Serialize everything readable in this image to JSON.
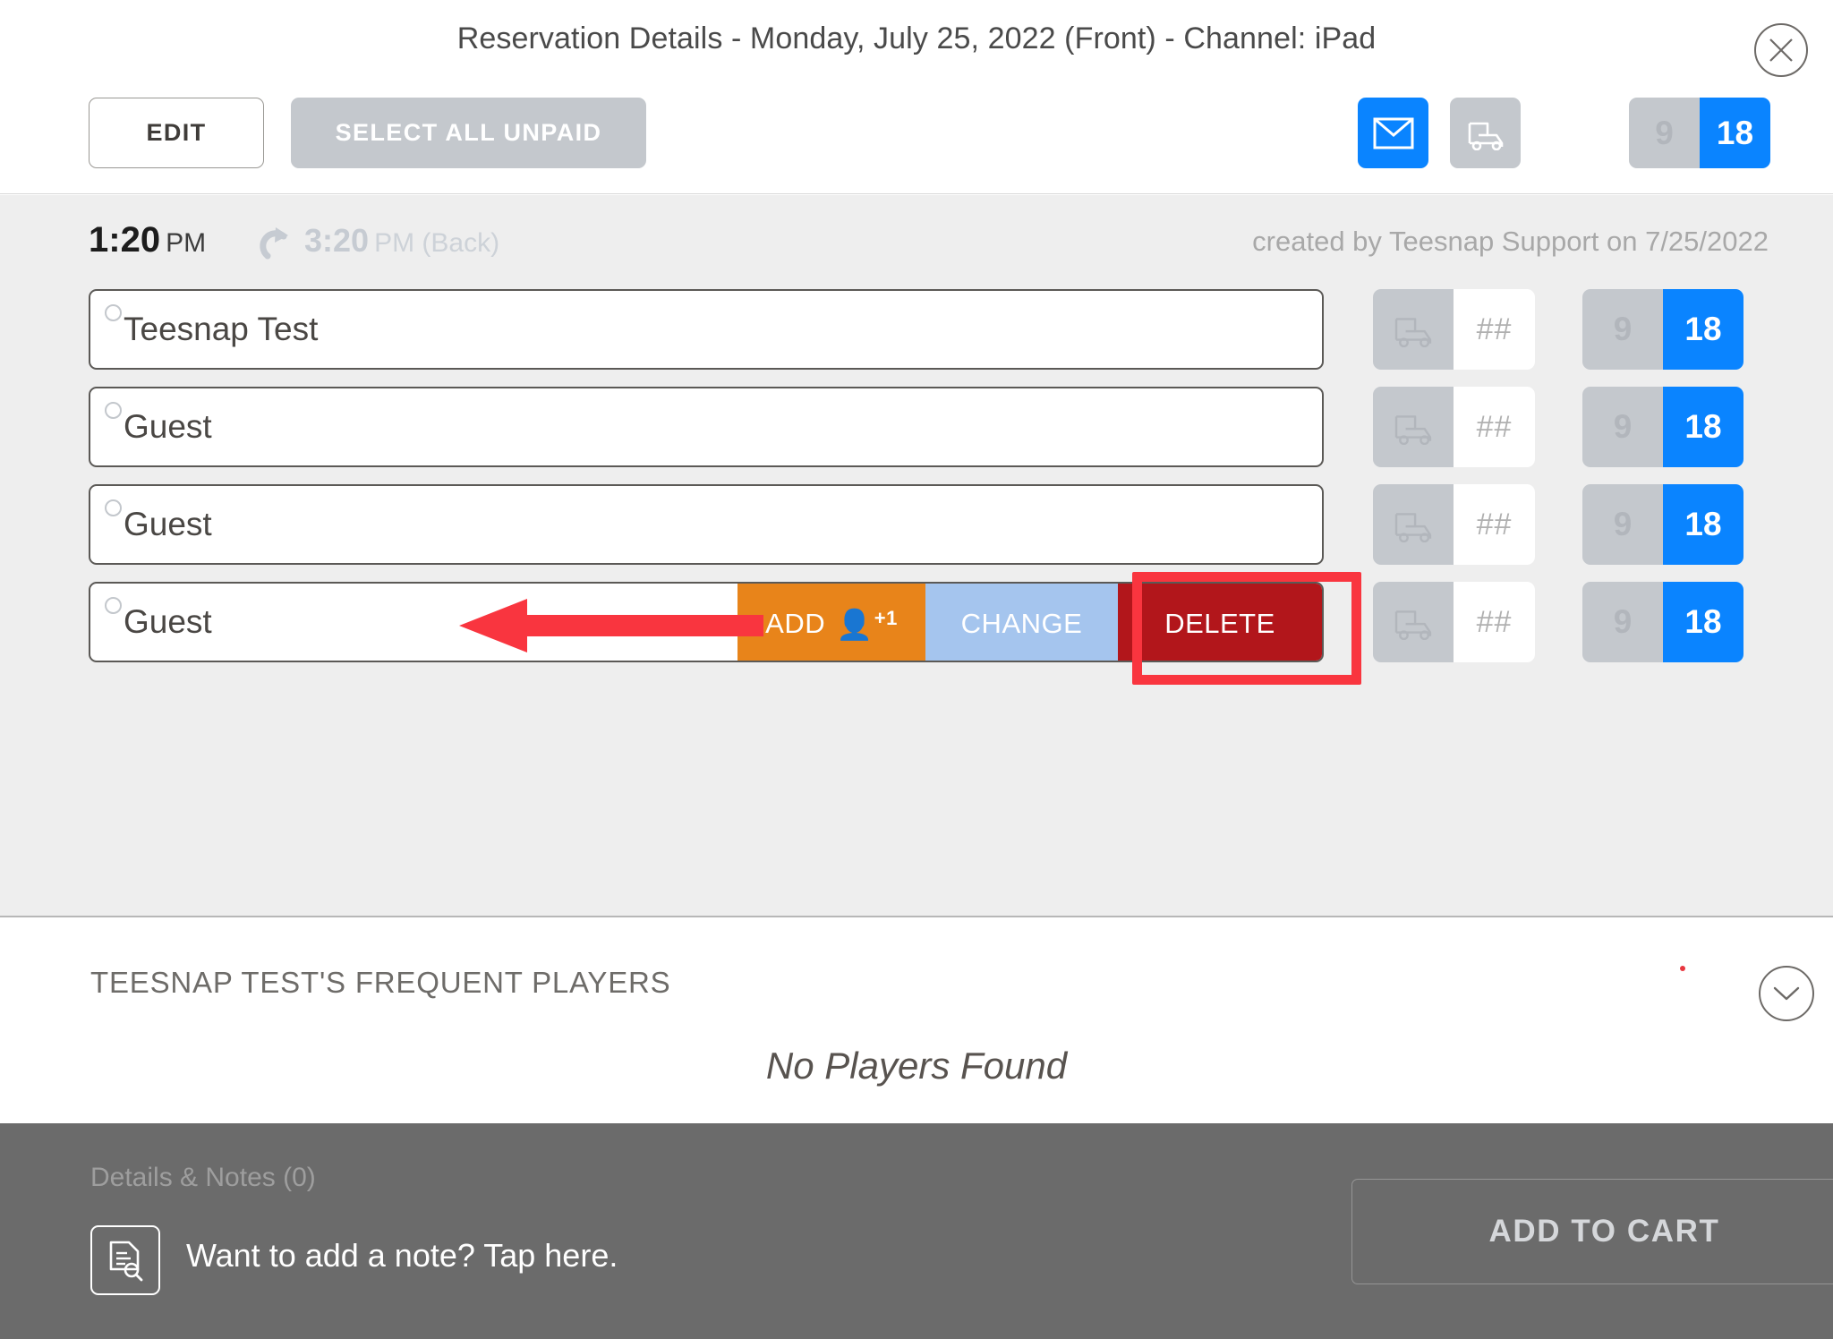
{
  "window": {
    "title": "Reservation Details - Monday, July 25, 2022 (Front) - Channel: iPad",
    "close_icon": "close-icon"
  },
  "toolbar": {
    "edit_label": "EDIT",
    "select_all_unpaid_label": "SELECT ALL UNPAID",
    "email_icon": "envelope-icon",
    "cart_icon": "golf-cart-icon",
    "holes": {
      "option_9": "9",
      "option_18": "18",
      "selected": "18"
    }
  },
  "reservation": {
    "start_time": "1:20",
    "start_ampm": "PM",
    "turn_icon": "turn-arrow-icon",
    "back_time": "3:20",
    "back_label": "PM (Back)",
    "created_by": "created by Teesnap Support on 7/25/2022"
  },
  "players": [
    {
      "name": "Teesnap Test",
      "cart_number": "##",
      "holes_9": "9",
      "holes_18": "18",
      "swipe_open": false
    },
    {
      "name": "Guest",
      "cart_number": "##",
      "holes_9": "9",
      "holes_18": "18",
      "swipe_open": false
    },
    {
      "name": "Guest",
      "cart_number": "##",
      "holes_9": "9",
      "holes_18": "18",
      "swipe_open": false
    },
    {
      "name": "Guest",
      "cart_number": "##",
      "holes_9": "9",
      "holes_18": "18",
      "swipe_open": true
    }
  ],
  "swipe_actions": {
    "add_label": "ADD",
    "add_badge": "+1",
    "change_label": "CHANGE",
    "delete_label": "DELETE"
  },
  "frequent_players": {
    "title": "TEESNAP TEST'S FREQUENT PLAYERS",
    "empty_message": "No Players Found",
    "chevron_icon": "chevron-down-icon"
  },
  "footer": {
    "details_notes_label": "Details & Notes (0)",
    "note_icon": "document-search-icon",
    "note_prompt": "Want to add a note? Tap here.",
    "add_to_cart_label": "ADD TO CART"
  },
  "colors": {
    "accent_blue": "#0a84ff",
    "muted_gray": "#c4c8cd",
    "add_orange": "#e8841a",
    "change_blue": "#a5c5ee",
    "delete_red": "#b2161b",
    "annotation_red": "#f9353f",
    "body_gray": "#eeeeee",
    "footer_gray": "#6b6b6b"
  }
}
